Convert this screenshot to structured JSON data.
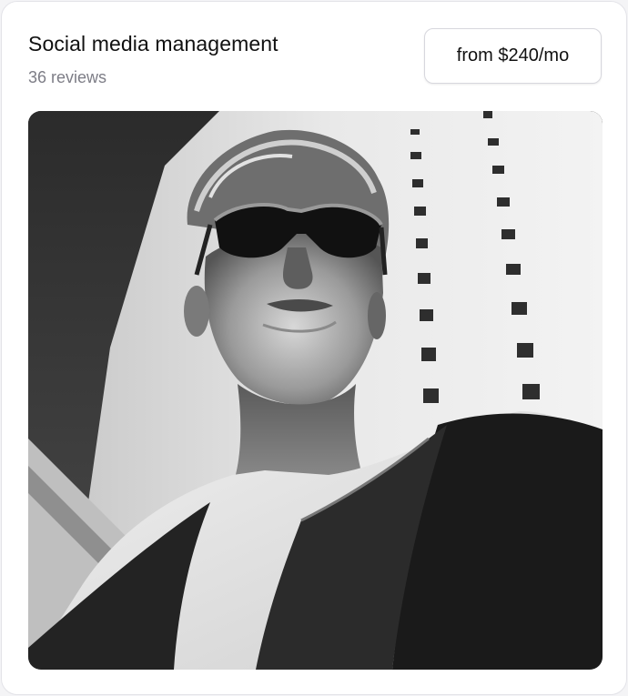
{
  "card": {
    "title": "Social media management",
    "reviews": "36 reviews",
    "price_button": "from $240/mo"
  },
  "image": {
    "subject": "black-and-white-portrait-man-sunglasses",
    "style": "grayscale"
  },
  "colors": {
    "title_text": "#111111",
    "subtitle_text": "#7d7d86",
    "border": "#e3e3e8",
    "background": "#ffffff"
  }
}
